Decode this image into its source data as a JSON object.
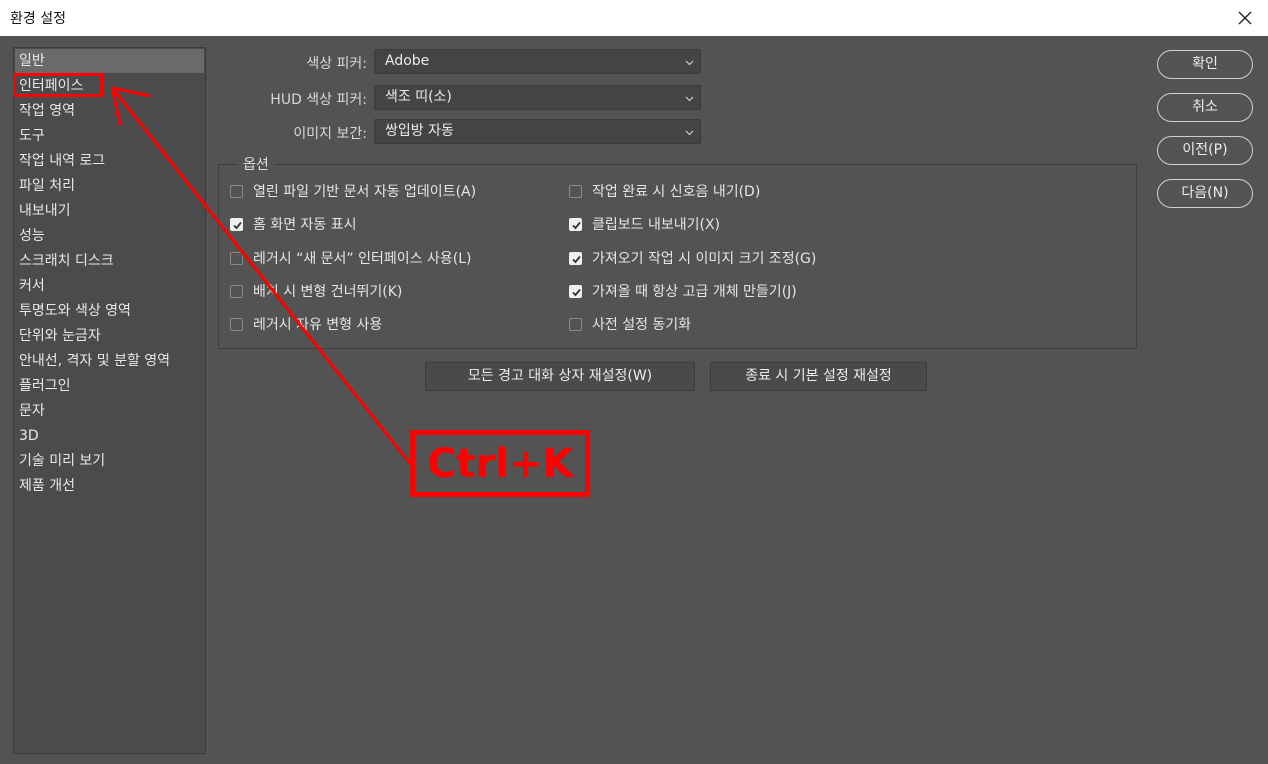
{
  "window": {
    "title": "환경 설정",
    "close_icon": "close-icon"
  },
  "sidebar": {
    "items": [
      {
        "label": "일반",
        "selected": true
      },
      {
        "label": "인터페이스",
        "selected": false
      },
      {
        "label": "작업 영역",
        "selected": false
      },
      {
        "label": "도구",
        "selected": false
      },
      {
        "label": "작업 내역 로그",
        "selected": false
      },
      {
        "label": "파일 처리",
        "selected": false
      },
      {
        "label": "내보내기",
        "selected": false
      },
      {
        "label": "성능",
        "selected": false
      },
      {
        "label": "스크래치 디스크",
        "selected": false
      },
      {
        "label": "커서",
        "selected": false
      },
      {
        "label": "투명도와 색상 영역",
        "selected": false
      },
      {
        "label": "단위와 눈금자",
        "selected": false
      },
      {
        "label": "안내선, 격자 및 분할 영역",
        "selected": false
      },
      {
        "label": "플러그인",
        "selected": false
      },
      {
        "label": "문자",
        "selected": false
      },
      {
        "label": "3D",
        "selected": false
      },
      {
        "label": "기술 미리 보기",
        "selected": false
      },
      {
        "label": "제품 개선",
        "selected": false
      }
    ]
  },
  "pickers": {
    "color_picker": {
      "label": "색상 피커:",
      "value": "Adobe"
    },
    "hud_color_picker": {
      "label": "HUD 색상 피커:",
      "value": "색조 띠(소)"
    },
    "image_interpolation": {
      "label": "이미지 보간:",
      "value": "쌍입방 자동"
    }
  },
  "options": {
    "legend": "옵션",
    "left": [
      {
        "label": "열린 파일 기반 문서 자동 업데이트(A)",
        "checked": false
      },
      {
        "label": "홈 화면 자동 표시",
        "checked": true
      },
      {
        "label": "레거시 “새 문서” 인터페이스 사용(L)",
        "checked": false
      },
      {
        "label": "배치 시 변형 건너뛰기(K)",
        "checked": false
      },
      {
        "label": "레거시 자유 변형 사용",
        "checked": false
      }
    ],
    "right": [
      {
        "label": "작업 완료 시 신호음 내기(D)",
        "checked": false
      },
      {
        "label": "클립보드 내보내기(X)",
        "checked": true
      },
      {
        "label": "가져오기 작업 시 이미지 크기 조정(G)",
        "checked": true
      },
      {
        "label": "가져올 때 항상 고급 개체 만들기(J)",
        "checked": true
      },
      {
        "label": "사전 설정 동기화",
        "checked": false
      }
    ]
  },
  "reset_buttons": {
    "warnings": "모든 경고 대화 상자 재설정(W)",
    "on_quit": "종료 시 기본 설정 재설정"
  },
  "actions": {
    "ok": "확인",
    "cancel": "취소",
    "prev": "이전(P)",
    "next": "다음(N)"
  },
  "annotation": {
    "shortcut": "Ctrl+K",
    "color": "#ff0000"
  },
  "colors": {
    "background": "#535353",
    "sidebar_selected": "#6a6a6a"
  }
}
